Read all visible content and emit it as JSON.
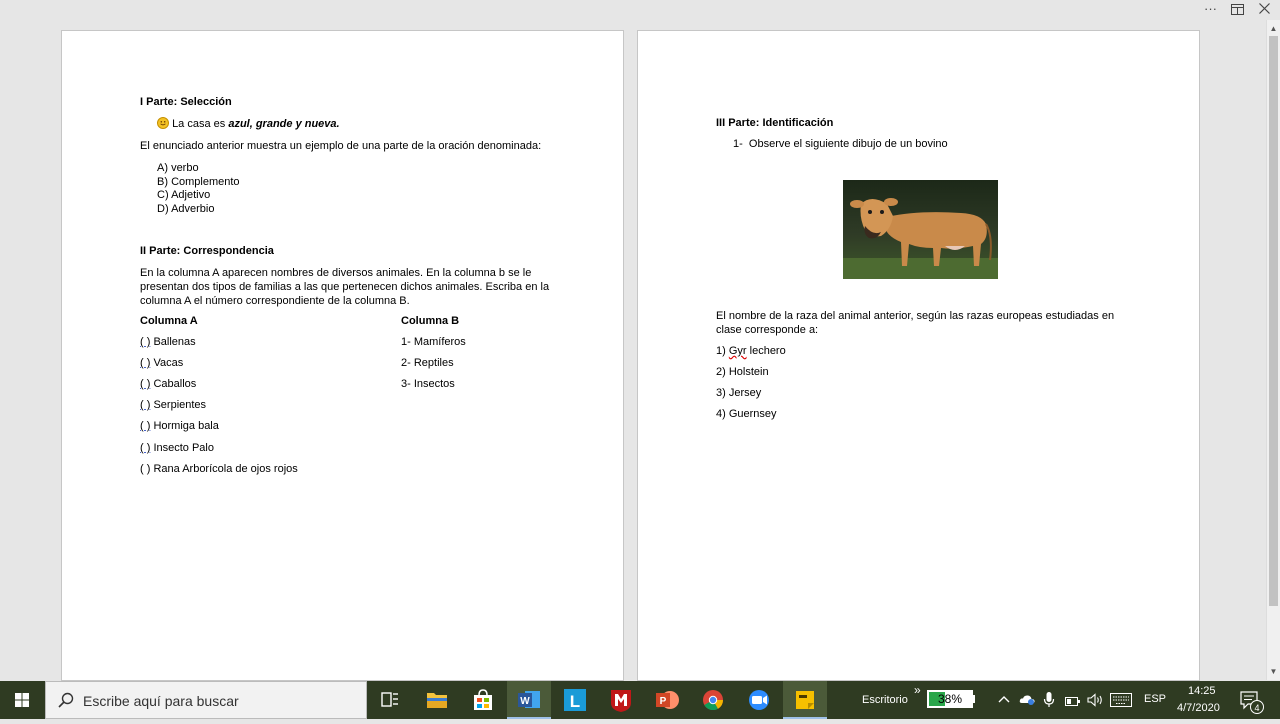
{
  "window": {
    "more_label": "···"
  },
  "left_page": {
    "part1_title": "I Parte: Selección",
    "sentence_prefix": "La casa es ",
    "sentence_emph": "azul, grande y nueva.",
    "prompt": "El enunciado anterior muestra un ejemplo de una parte de la oración denominada:",
    "options": [
      {
        "letter": "A)",
        "text": "verbo"
      },
      {
        "letter": "B)",
        "text": "Complemento"
      },
      {
        "letter": "C)",
        "text": "Adjetivo"
      },
      {
        "letter": "D)",
        "text": "Adverbio"
      }
    ],
    "part2_title": "II Parte: Correspondencia",
    "part2_instructions": "En la columna A aparecen nombres de diversos animales. En la columna b se le presentan dos tipos de familias a las que pertenecen dichos animales. Escriba en la columna A el número correspondiente de la columna B.",
    "col_a_header": "Columna A",
    "col_b_header": "Columna B",
    "col_a": [
      {
        "paren": "( )",
        "text": "Ballenas"
      },
      {
        "paren": "( )",
        "text": "Vacas"
      },
      {
        "paren": "( )",
        "text": "Caballos"
      },
      {
        "paren": "( )",
        "text": "Serpientes"
      },
      {
        "paren": "( )",
        "text": "Hormiga bala"
      },
      {
        "paren": "( )",
        "text": "Insecto Palo"
      },
      {
        "paren": "( )",
        "text": "Rana Arborícola de ojos rojos"
      }
    ],
    "col_b": [
      "1- Mamíferos",
      "2- Reptiles",
      "3- Insectos"
    ]
  },
  "right_page": {
    "part3_title": "III Parte: Identificación",
    "item_number": "1-",
    "item_text": "Observe el siguiente dibujo de un bovino",
    "question": "El nombre de la raza del animal anterior, según las razas europeas estudiadas en clase corresponde a:",
    "answers": [
      {
        "num": "1)",
        "word": "Gyr",
        "rest": " lechero"
      },
      {
        "num": "2)",
        "word": "",
        "rest": "Holstein"
      },
      {
        "num": "3)",
        "word": "",
        "rest": "Jersey"
      },
      {
        "num": "4)",
        "word": "",
        "rest": "Guernsey"
      }
    ]
  },
  "taskbar": {
    "search_placeholder": "Escribe aquí para buscar",
    "desktop_label": "Escritorio",
    "expand_label": "»",
    "battery": "38%",
    "language": "ESP",
    "time": "14:25",
    "date": "4/7/2020",
    "notifications": "4"
  },
  "colors": {
    "taskbar": "#2f3b22",
    "word_blue": "#2b579a",
    "accent_yellow": "#f6c000"
  }
}
